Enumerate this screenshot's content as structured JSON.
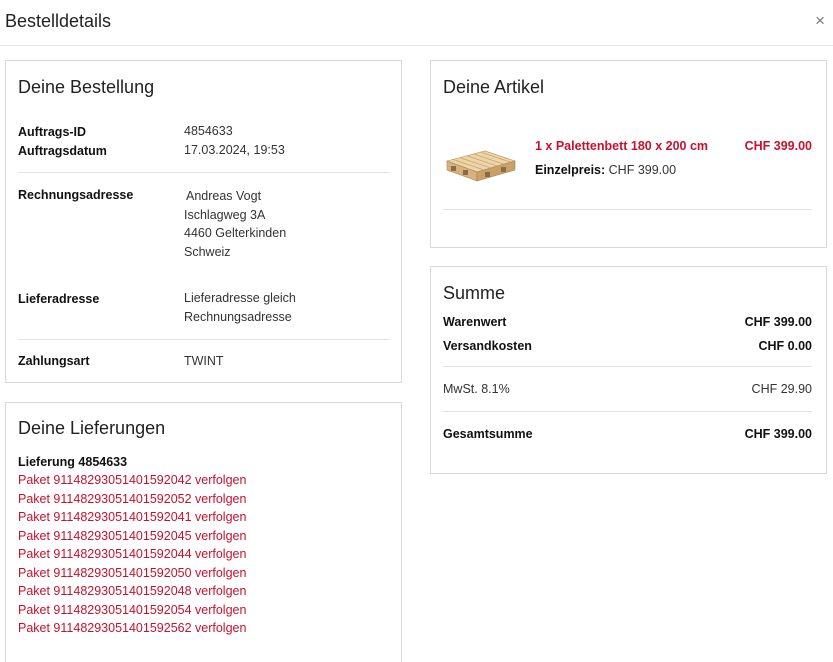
{
  "modal": {
    "title": "Bestelldetails",
    "close_symbol": "×"
  },
  "order": {
    "title": "Deine Bestellung",
    "rows": [
      {
        "label": "Auftrags-ID",
        "value": "4854633"
      },
      {
        "label": "Auftragsdatum",
        "value": "17.03.2024, 19:53"
      }
    ],
    "billing": {
      "label": "Rechnungsadresse",
      "lines": [
        "Andreas Vogt",
        "Ischlagweg 3A",
        "4460 Gelterkinden",
        "Schweiz"
      ]
    },
    "shipping": {
      "label": "Lieferadresse",
      "lines": [
        "Lieferadresse gleich",
        "Rechnungsadresse"
      ]
    },
    "payment": {
      "label": "Zahlungsart",
      "value": "TWINT"
    }
  },
  "deliveries": {
    "title": "Deine Lieferungen",
    "delivery_label": "Lieferung 4854633",
    "packages": [
      "Paket 91148293051401592042 verfolgen",
      "Paket 91148293051401592052 verfolgen",
      "Paket 91148293051401592041 verfolgen",
      "Paket 91148293051401592045 verfolgen",
      "Paket 91148293051401592044 verfolgen",
      "Paket 91148293051401592050 verfolgen",
      "Paket 91148293051401592048 verfolgen",
      "Paket 91148293051401592054 verfolgen",
      "Paket 91148293051401592562 verfolgen"
    ]
  },
  "articles": {
    "title": "Deine Artikel",
    "item": {
      "name": "1 x Palettenbett 180 x 200 cm",
      "price": "CHF 399.00",
      "unit_price_label": "Einzelpreis:",
      "unit_price": "CHF 399.00",
      "image": "pallet-bed-image"
    }
  },
  "summary": {
    "title": "Summe",
    "rows": [
      {
        "label": "Warenwert",
        "value": "CHF 399.00"
      },
      {
        "label": "Versandkosten",
        "value": "CHF 0.00"
      }
    ],
    "vat": {
      "label": "MwSt. 8.1%",
      "value": "CHF 29.90"
    },
    "total": {
      "label": "Gesamtsumme",
      "value": "CHF 399.00"
    }
  },
  "colors": {
    "accent_red": "#c8102e",
    "border": "#d9d9d9",
    "separator": "#e3e3e3"
  }
}
